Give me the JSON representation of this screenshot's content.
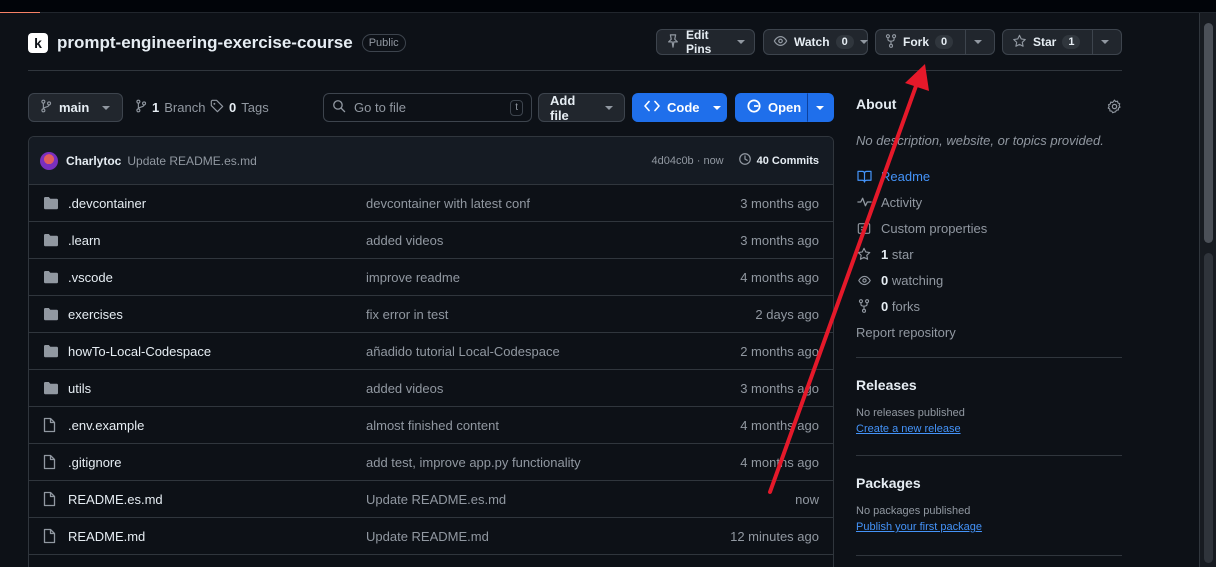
{
  "repo": {
    "name": "prompt-engineering-exercise-course",
    "visibility": "Public",
    "logo_letter": "k"
  },
  "actions": {
    "edit_pins": "Edit Pins",
    "watch": "Watch",
    "watch_count": "0",
    "fork": "Fork",
    "fork_count": "0",
    "star": "Star",
    "star_count": "1"
  },
  "toolbar": {
    "branch": "main",
    "branch_count": "1",
    "branch_label": "Branch",
    "tag_count": "0",
    "tag_label": "Tags",
    "search_placeholder": "Go to file",
    "search_shortcut": "t",
    "add_file": "Add file",
    "code": "Code",
    "open": "Open"
  },
  "latest_commit": {
    "author": "Charlytoc",
    "message": "Update README.es.md",
    "hash_time": "4d04c0b · now",
    "commits": "40 Commits"
  },
  "files": [
    {
      "type": "dir",
      "name": ".devcontainer",
      "commit": "devcontainer with latest conf",
      "time": "3 months ago"
    },
    {
      "type": "dir",
      "name": ".learn",
      "commit": "added videos",
      "time": "3 months ago"
    },
    {
      "type": "dir",
      "name": ".vscode",
      "commit": "improve readme",
      "time": "4 months ago"
    },
    {
      "type": "dir",
      "name": "exercises",
      "commit": "fix error in test",
      "time": "2 days ago"
    },
    {
      "type": "dir",
      "name": "howTo-Local-Codespace",
      "commit": "añadido tutorial Local-Codespace",
      "time": "2 months ago"
    },
    {
      "type": "dir",
      "name": "utils",
      "commit": "added videos",
      "time": "3 months ago"
    },
    {
      "type": "file",
      "name": ".env.example",
      "commit": "almost finished content",
      "time": "4 months ago"
    },
    {
      "type": "file",
      "name": ".gitignore",
      "commit": "add test, improve app.py functionality",
      "time": "4 months ago"
    },
    {
      "type": "file",
      "name": "README.es.md",
      "commit": "Update README.es.md",
      "time": "now"
    },
    {
      "type": "file",
      "name": "README.md",
      "commit": "Update README.md",
      "time": "12 minutes ago"
    }
  ],
  "about": {
    "title": "About",
    "description": "No description, website, or topics provided.",
    "readme": "Readme",
    "activity": "Activity",
    "custom_properties": "Custom properties",
    "stars_count": "1",
    "stars_label": "star",
    "watching_count": "0",
    "watching_label": "watching",
    "forks_count": "0",
    "forks_label": "forks",
    "report": "Report repository"
  },
  "releases": {
    "title": "Releases",
    "empty": "No releases published",
    "link": "Create a new release"
  },
  "packages": {
    "title": "Packages",
    "empty": "No packages published",
    "link": "Publish your first package"
  },
  "colors": {
    "annotation_arrow": "#e5192a",
    "primary": "#1f6feb",
    "link": "#4493f8"
  }
}
